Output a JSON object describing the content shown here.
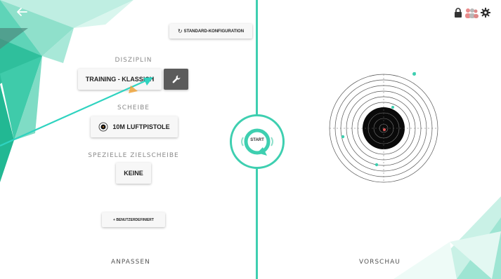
{
  "nav": {
    "back_icon": "arrow-left-icon"
  },
  "left_panel": {
    "reset_button_label": "STANDARD-KONFIGURATION",
    "discipline_heading": "DISZIPLIN",
    "discipline_value": "TRAINING - KLASSICH",
    "target_heading": "SCHEIBE",
    "target_value": "10M LUFTPISTOLE",
    "special_target_heading": "SPEZIELLE ZIELSCHEIBE",
    "special_target_value": "KEINE",
    "custom_button_label": "+ BENUTZERDEFINIERT",
    "footer_label": "ANPASSEN"
  },
  "center": {
    "start_label": "START"
  },
  "right_panel": {
    "footer_label": "VORSCHAU"
  },
  "top_right_icons": [
    "lock-icon",
    "users-icon",
    "gear-icon"
  ],
  "colors": {
    "accent": "#3ecfb0",
    "dark_accent": "#1aa889",
    "target_black": "#0a0a0a"
  }
}
